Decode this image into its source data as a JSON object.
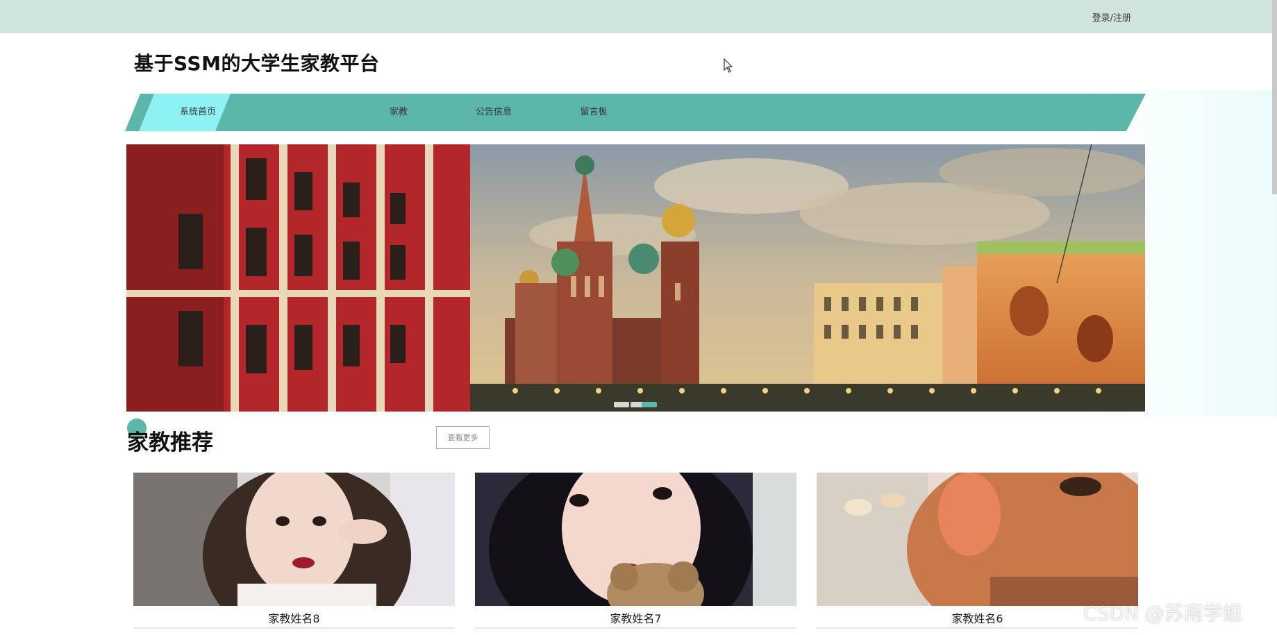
{
  "header": {
    "login_label": "登录/注册",
    "site_title": "基于SSM的大学生家教平台"
  },
  "nav": {
    "items": [
      {
        "label": "系统首页",
        "active": true
      },
      {
        "label": "家教",
        "active": false
      },
      {
        "label": "公告信息",
        "active": false
      },
      {
        "label": "留言板",
        "active": false
      }
    ],
    "bar_color": "#5cb6aa",
    "active_color": "#8ef2f2"
  },
  "banner": {
    "slide_count": 3,
    "active_slide": 3
  },
  "recommend": {
    "title": "家教推荐",
    "more_label": "查看更多",
    "cards": [
      {
        "name": "家教姓名8"
      },
      {
        "name": "家教姓名7"
      },
      {
        "name": "家教姓名6"
      }
    ]
  },
  "watermark": "CSDN @苏南学姐",
  "colors": {
    "topbar": "#cfe4dc",
    "accent": "#5cb6aa"
  }
}
